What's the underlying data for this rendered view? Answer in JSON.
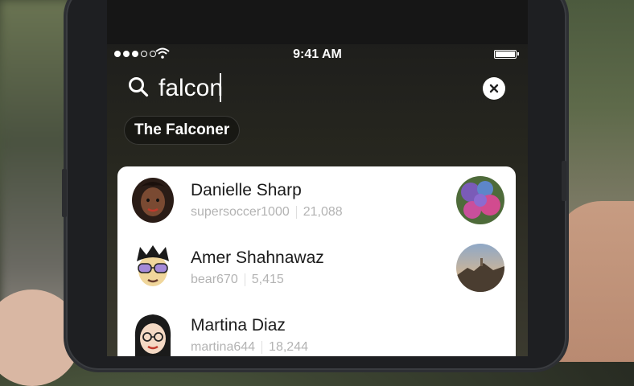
{
  "status_bar": {
    "time": "9:41 AM",
    "signal_icon": "signal-dots-icon",
    "wifi_icon": "wifi-icon",
    "battery_icon": "battery-icon"
  },
  "search": {
    "value": "falcon",
    "search_icon": "search-icon",
    "clear_icon": "close-icon"
  },
  "suggestion_chip": {
    "label": "The Falconer"
  },
  "results": [
    {
      "name": "Danielle Sharp",
      "username": "supersoccer1000",
      "score": "21,088"
    },
    {
      "name": "Amer Shahnawaz",
      "username": "bear670",
      "score": "5,415"
    },
    {
      "name": "Martina Diaz",
      "username": "martina644",
      "score": "18,244"
    }
  ],
  "colors": {
    "card_bg": "#ffffff",
    "name_text": "#1a1a1a",
    "meta_text": "#b3b3b3"
  }
}
